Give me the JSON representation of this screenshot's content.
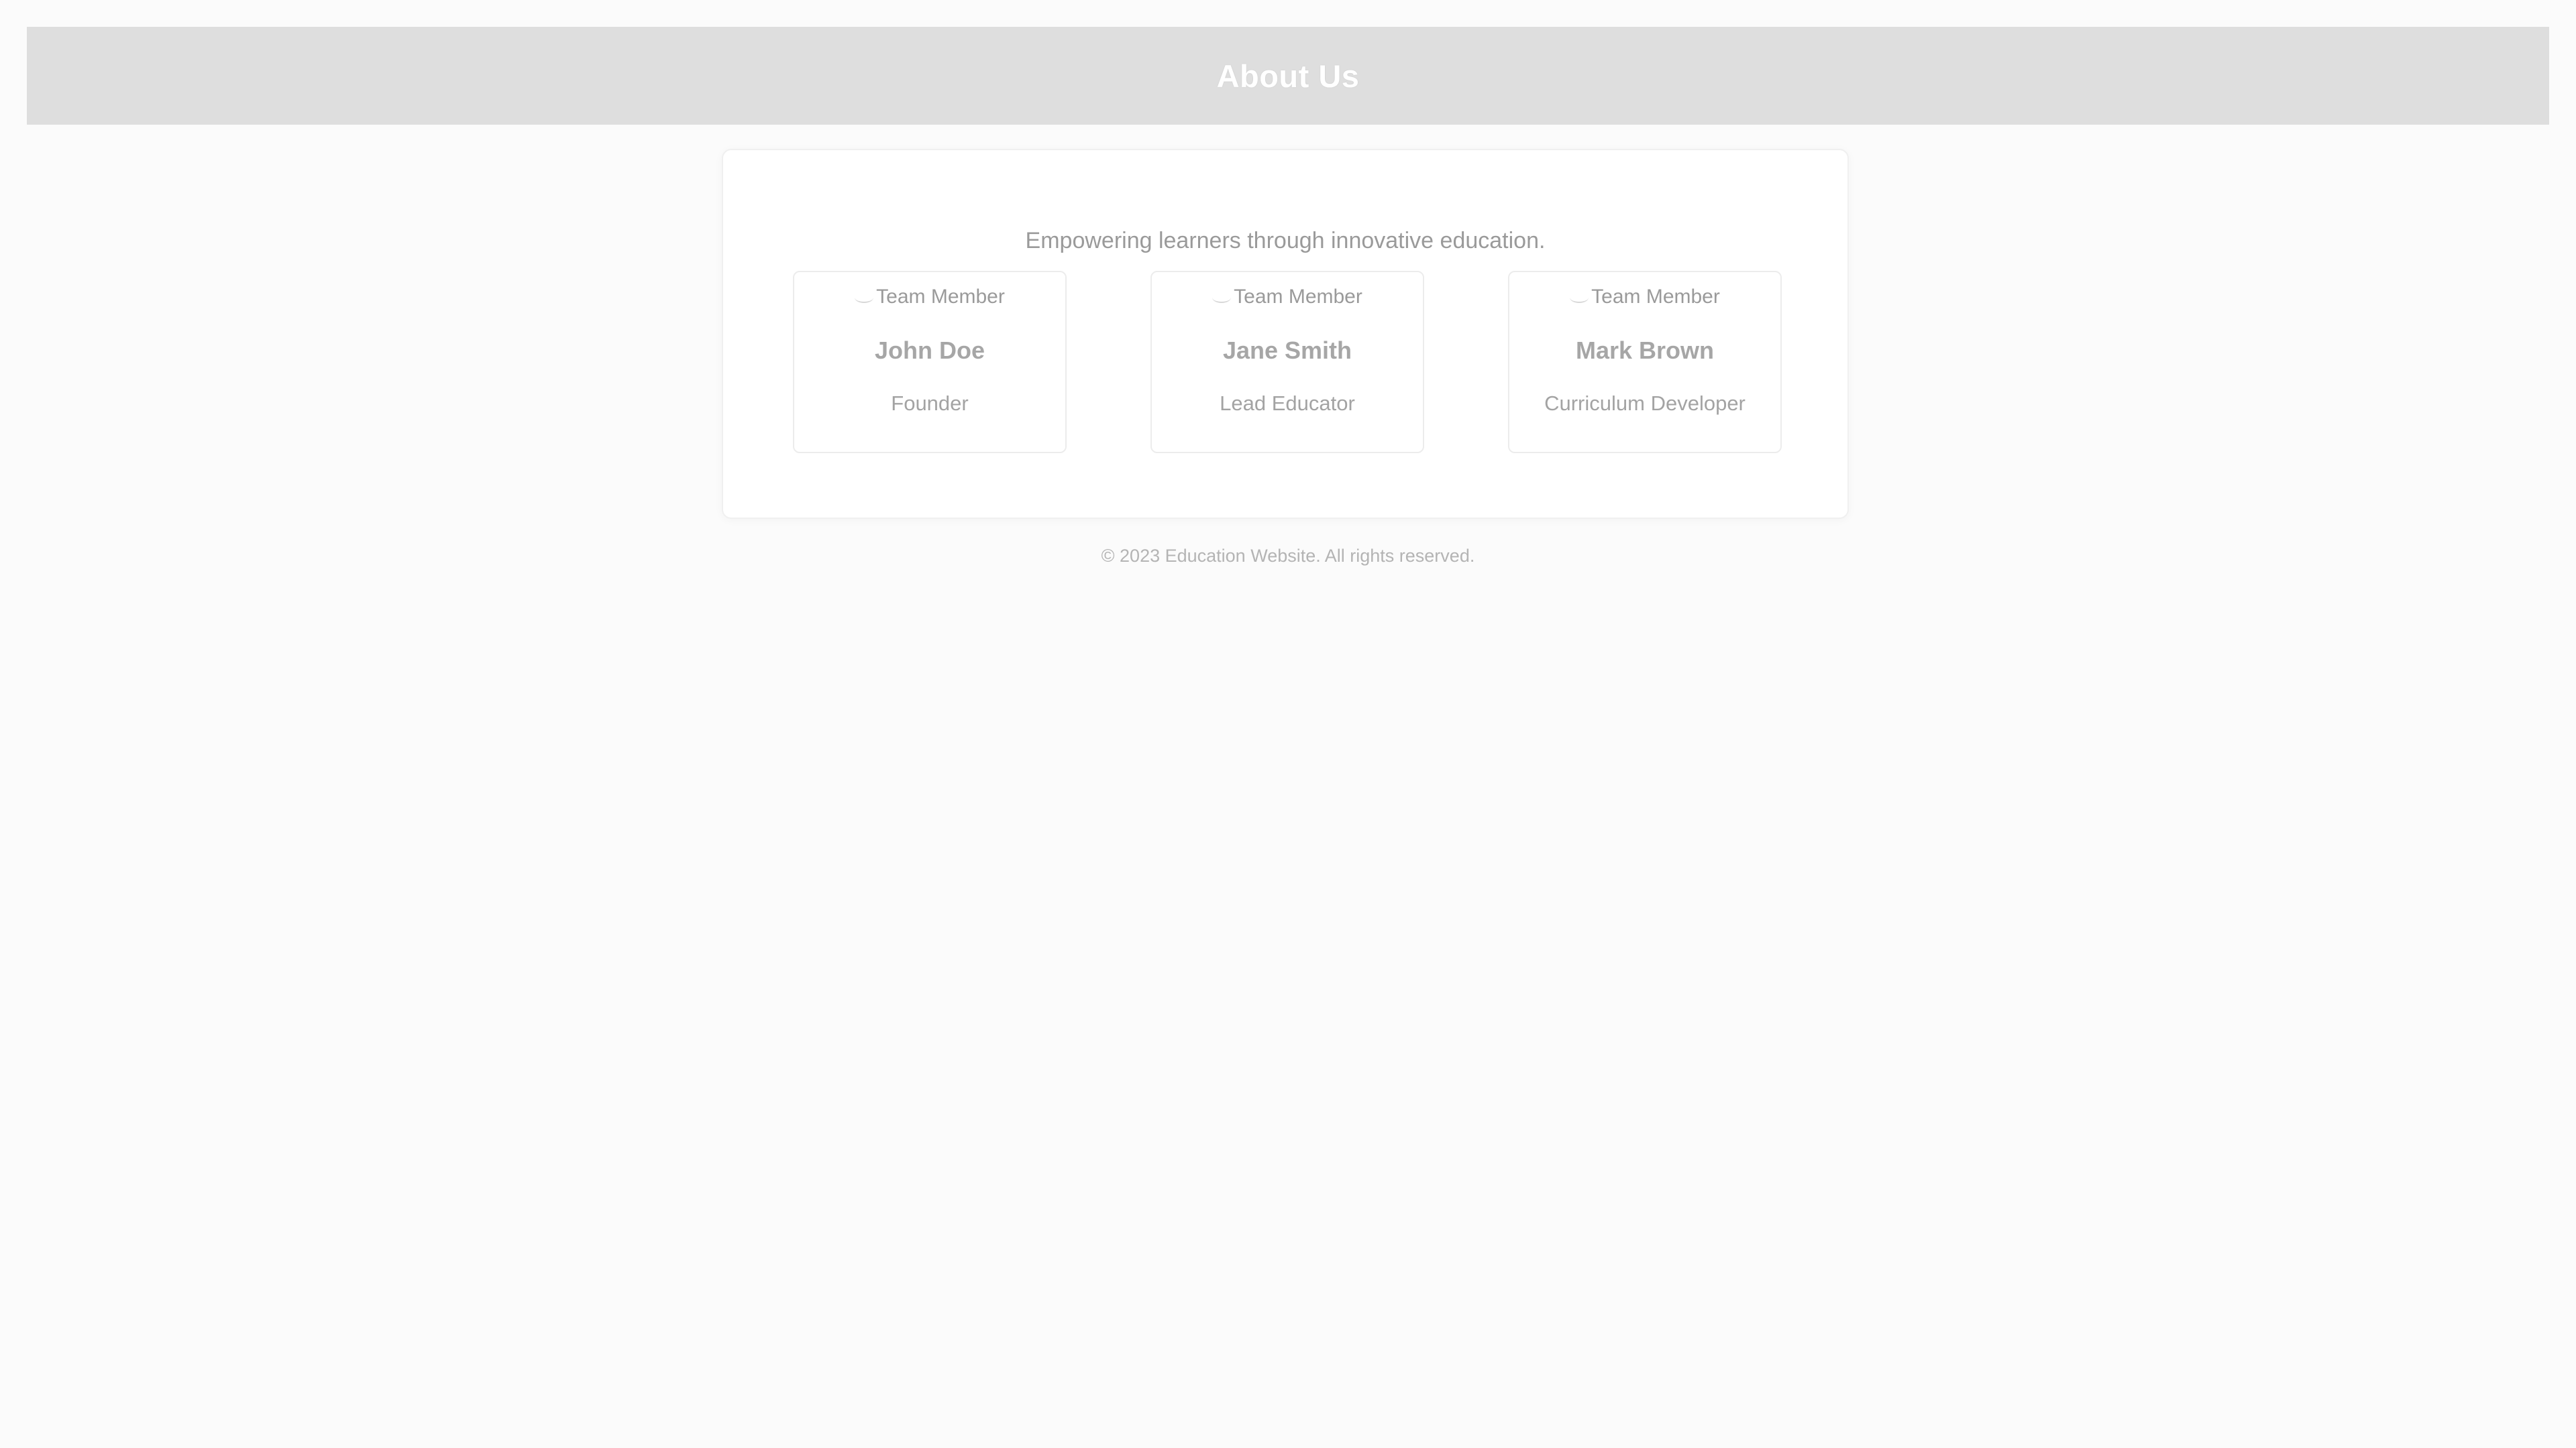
{
  "header": {
    "title": "About Us",
    "background": "#dedede"
  },
  "main": {
    "tagline": "Empowering learners through innovative education.",
    "team": [
      {
        "image_alt": "Team Member",
        "name": "John Doe",
        "role": "Founder"
      },
      {
        "image_alt": "Team Member",
        "name": "Jane Smith",
        "role": "Lead Educator"
      },
      {
        "image_alt": "Team Member",
        "name": "Mark Brown",
        "role": "Curriculum Developer"
      }
    ]
  },
  "footer": {
    "text": "© 2023 Education Website. All rights reserved."
  }
}
